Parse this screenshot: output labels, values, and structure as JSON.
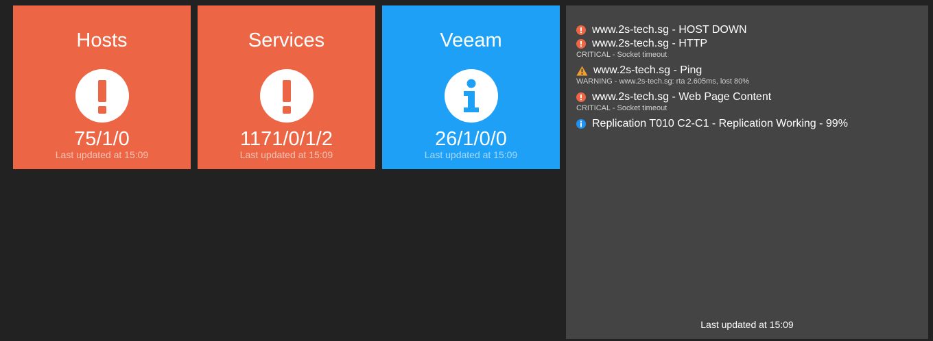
{
  "colors": {
    "background": "#222222",
    "critical_tile": "#EC6645",
    "info_tile": "#1EA0F7",
    "panel": "#444444",
    "critical_icon": "#EC6645",
    "warning_icon": "#F0A030",
    "info_icon": "#1E90F0"
  },
  "tiles": [
    {
      "title": "Hosts",
      "icon": "exclamation-icon",
      "status": "critical",
      "value": "75/1/0",
      "updated": "Last updated at 15:09"
    },
    {
      "title": "Services",
      "icon": "exclamation-icon",
      "status": "critical",
      "value": "1171/0/1/2",
      "updated": "Last updated at 15:09"
    },
    {
      "title": "Veeam",
      "icon": "info-icon",
      "status": "info",
      "value": "26/1/0/0",
      "updated": "Last updated at 15:09"
    }
  ],
  "alerts": [
    {
      "icon": "exclamation-circle-icon",
      "severity": "critical",
      "title": "www.2s-tech.sg - HOST DOWN",
      "detail": ""
    },
    {
      "icon": "exclamation-circle-icon",
      "severity": "critical",
      "title": "www.2s-tech.sg - HTTP",
      "detail": "CRITICAL - Socket timeout"
    },
    {
      "icon": "warning-triangle-icon",
      "severity": "warning",
      "title": "www.2s-tech.sg - Ping",
      "detail": "WARNING - www.2s-tech.sg: rta 2.605ms, lost 80%"
    },
    {
      "icon": "exclamation-circle-icon",
      "severity": "critical",
      "title": "www.2s-tech.sg - Web Page Content",
      "detail": "CRITICAL - Socket timeout"
    },
    {
      "icon": "info-circle-icon",
      "severity": "info",
      "title": "Replication T010 C2-C1 - Replication Working - 99%",
      "detail": ""
    }
  ],
  "panel": {
    "updated": "Last updated at 15:09"
  }
}
